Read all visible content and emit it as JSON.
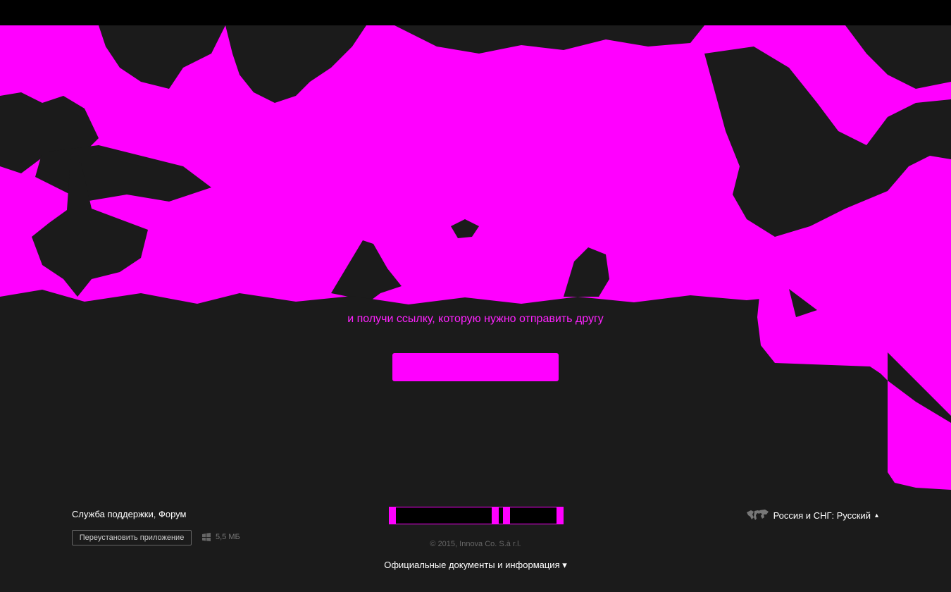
{
  "hero": {
    "title": "",
    "subtitle": "",
    "invite_line1": "",
    "invite_line2": "и получи ссылку, которую нужно отправить другу",
    "cta_label": ""
  },
  "footer": {
    "support_link": "Служба поддержки",
    "separator": ",",
    "forum_link": "Форум",
    "reinstall_button": "Переустановить приложение",
    "download_size": "5,5 МБ",
    "copyright": "© 2015, Innova Co. S.à r.l.",
    "docs_link": "Официальные документы и информация",
    "docs_arrow": "▾",
    "region_label": "Россия и СНГ: Русский",
    "region_arrow": "▴"
  },
  "colors": {
    "accent": "#ff00ff",
    "background": "#1b1b1b",
    "topbar": "#000000"
  },
  "icons": {
    "windows": "windows-icon",
    "globe": "globe-icon"
  }
}
